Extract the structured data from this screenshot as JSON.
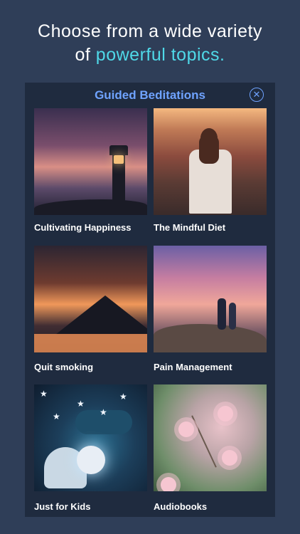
{
  "headline": {
    "line1": "Choose from a wide variety",
    "line2_prefix": "of ",
    "line2_accent": "powerful topics."
  },
  "panel": {
    "title": "Guided Beditations",
    "close_icon": "close-icon"
  },
  "tiles": [
    {
      "label": "Cultivating Happiness",
      "icon": "lighthouse-photo"
    },
    {
      "label": "The Mindful Diet",
      "icon": "sunset-field-photo"
    },
    {
      "label": "Quit smoking",
      "icon": "mountain-sunset-photo"
    },
    {
      "label": "Pain Management",
      "icon": "couple-sunset-photo"
    },
    {
      "label": "Just for Kids",
      "icon": "child-moon-photo"
    },
    {
      "label": "Audiobooks",
      "icon": "cherry-blossom-photo"
    }
  ],
  "colors": {
    "background": "#2f3e58",
    "panel": "#1f2b3f",
    "accent_cyan": "#4fd9e8",
    "title_blue": "#6fa3ff"
  }
}
